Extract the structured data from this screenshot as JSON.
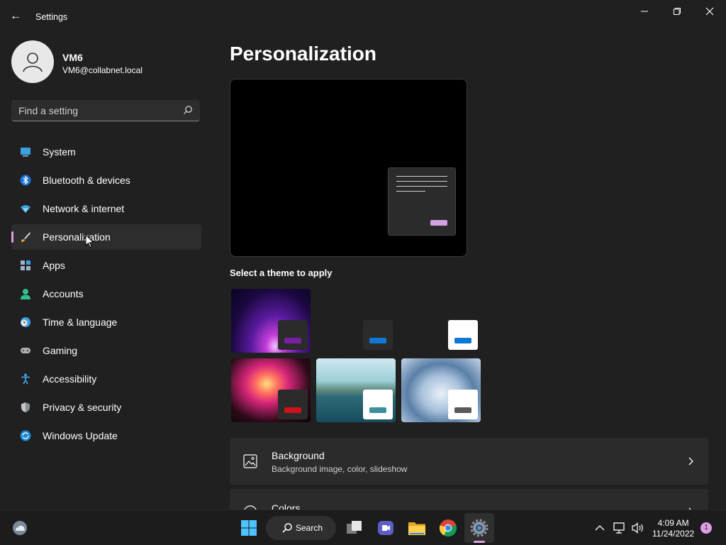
{
  "window": {
    "app_title": "Settings",
    "back_glyph": "←",
    "controls": [
      "minimize-icon",
      "restore-icon",
      "close-icon"
    ]
  },
  "user": {
    "name": "VM6",
    "email": "VM6@collabnet.local"
  },
  "search": {
    "placeholder": "Find a setting"
  },
  "nav": {
    "items": [
      {
        "label": "System",
        "icon": "system-icon"
      },
      {
        "label": "Bluetooth & devices",
        "icon": "bluetooth-icon"
      },
      {
        "label": "Network & internet",
        "icon": "wifi-icon"
      },
      {
        "label": "Personalization",
        "icon": "brush-icon",
        "active": true
      },
      {
        "label": "Apps",
        "icon": "apps-icon"
      },
      {
        "label": "Accounts",
        "icon": "accounts-icon"
      },
      {
        "label": "Time & language",
        "icon": "clock-globe-icon"
      },
      {
        "label": "Gaming",
        "icon": "gamepad-icon"
      },
      {
        "label": "Accessibility",
        "icon": "accessibility-icon"
      },
      {
        "label": "Privacy & security",
        "icon": "shield-icon"
      },
      {
        "label": "Windows Update",
        "icon": "update-icon"
      }
    ],
    "accent_color": "#e39de8"
  },
  "main": {
    "title": "Personalization",
    "themes_label": "Select a theme to apply",
    "themes": [
      {
        "name": "glow-dark",
        "bar_color": "#7a1fa2"
      },
      {
        "name": "dark",
        "bar_color": "#0e78d4"
      },
      {
        "name": "light",
        "bar_color": "#0e78d4"
      },
      {
        "name": "captured-motion",
        "bar_color": "#d0101b"
      },
      {
        "name": "flow",
        "bar_color": "#3d8f9e"
      },
      {
        "name": "sunrise-bloom",
        "bar_color": "#5a5a5a"
      }
    ],
    "cards": [
      {
        "title": "Background",
        "subtitle": "Background image, color, slideshow",
        "icon": "image-icon"
      },
      {
        "title": "Colors",
        "subtitle": "",
        "icon": "palette-icon"
      }
    ]
  },
  "taskbar": {
    "search_label": "Search",
    "time": "4:09 AM",
    "date": "11/24/2022",
    "notification_count": "1"
  }
}
